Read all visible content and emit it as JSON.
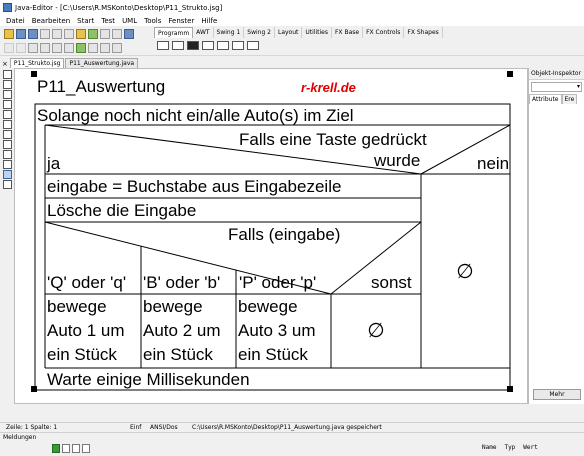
{
  "window": {
    "title": "Java-Editor - [C:\\Users\\R.MSKonto\\Desktop\\P11_Strukto.jsg]"
  },
  "menu": [
    "Datei",
    "Bearbeiten",
    "Start",
    "Test",
    "UML",
    "Tools",
    "Fenster",
    "Hilfe"
  ],
  "palette": {
    "tabs": [
      "Programm",
      "AWT",
      "Swing 1",
      "Swing 2",
      "Layout",
      "Utilities",
      "FX Base",
      "FX Controls",
      "FX Shapes"
    ],
    "active": "Programm"
  },
  "file_tabs": [
    {
      "label": "P11_Strukto.jsg",
      "active": true
    },
    {
      "label": "P11_Auswertung.java",
      "active": false
    }
  ],
  "diagram": {
    "title": "P11_Auswertung",
    "watermark": "r-krell.de",
    "loop": "Solange noch nicht ein/alle Auto(s) im Ziel",
    "if_condition_line1": "Falls eine Taste gedrückt",
    "if_condition_line2": "wurde",
    "if_yes": "ja",
    "if_no": "nein",
    "stmt1": "eingabe = Buchstabe aus Eingabezeile",
    "stmt2": "Lösche die Eingabe",
    "switch_condition": "Falls (eingabe)",
    "cases": [
      "'Q' oder 'q'",
      "'B' oder 'b'",
      "'P' oder 'p'",
      "sonst"
    ],
    "case_lines": [
      [
        "bewege",
        "Auto 1 um",
        "ein Stück"
      ],
      [
        "bewege",
        "Auto 2 um",
        "ein Stück"
      ],
      [
        "bewege",
        "Auto 3 um",
        "ein Stück"
      ]
    ],
    "empty_symbol": "∅",
    "final": "Warte einige Millisekunden"
  },
  "inspector": {
    "title": "Objekt-Inspektor",
    "tabs": [
      "Attribute",
      "Ere"
    ],
    "more_button": "Mehr"
  },
  "status": {
    "position": "Zeile:  1 Spalte:  1",
    "mode": "Einf",
    "encoding": "ANSI/Dos",
    "message": "C:\\Users\\R.MSKonto\\Desktop\\P11_Auswertung.java gespeichert"
  },
  "messages": {
    "label": "Meldungen",
    "columns": [
      "Name",
      "Typ",
      "Wert"
    ]
  }
}
